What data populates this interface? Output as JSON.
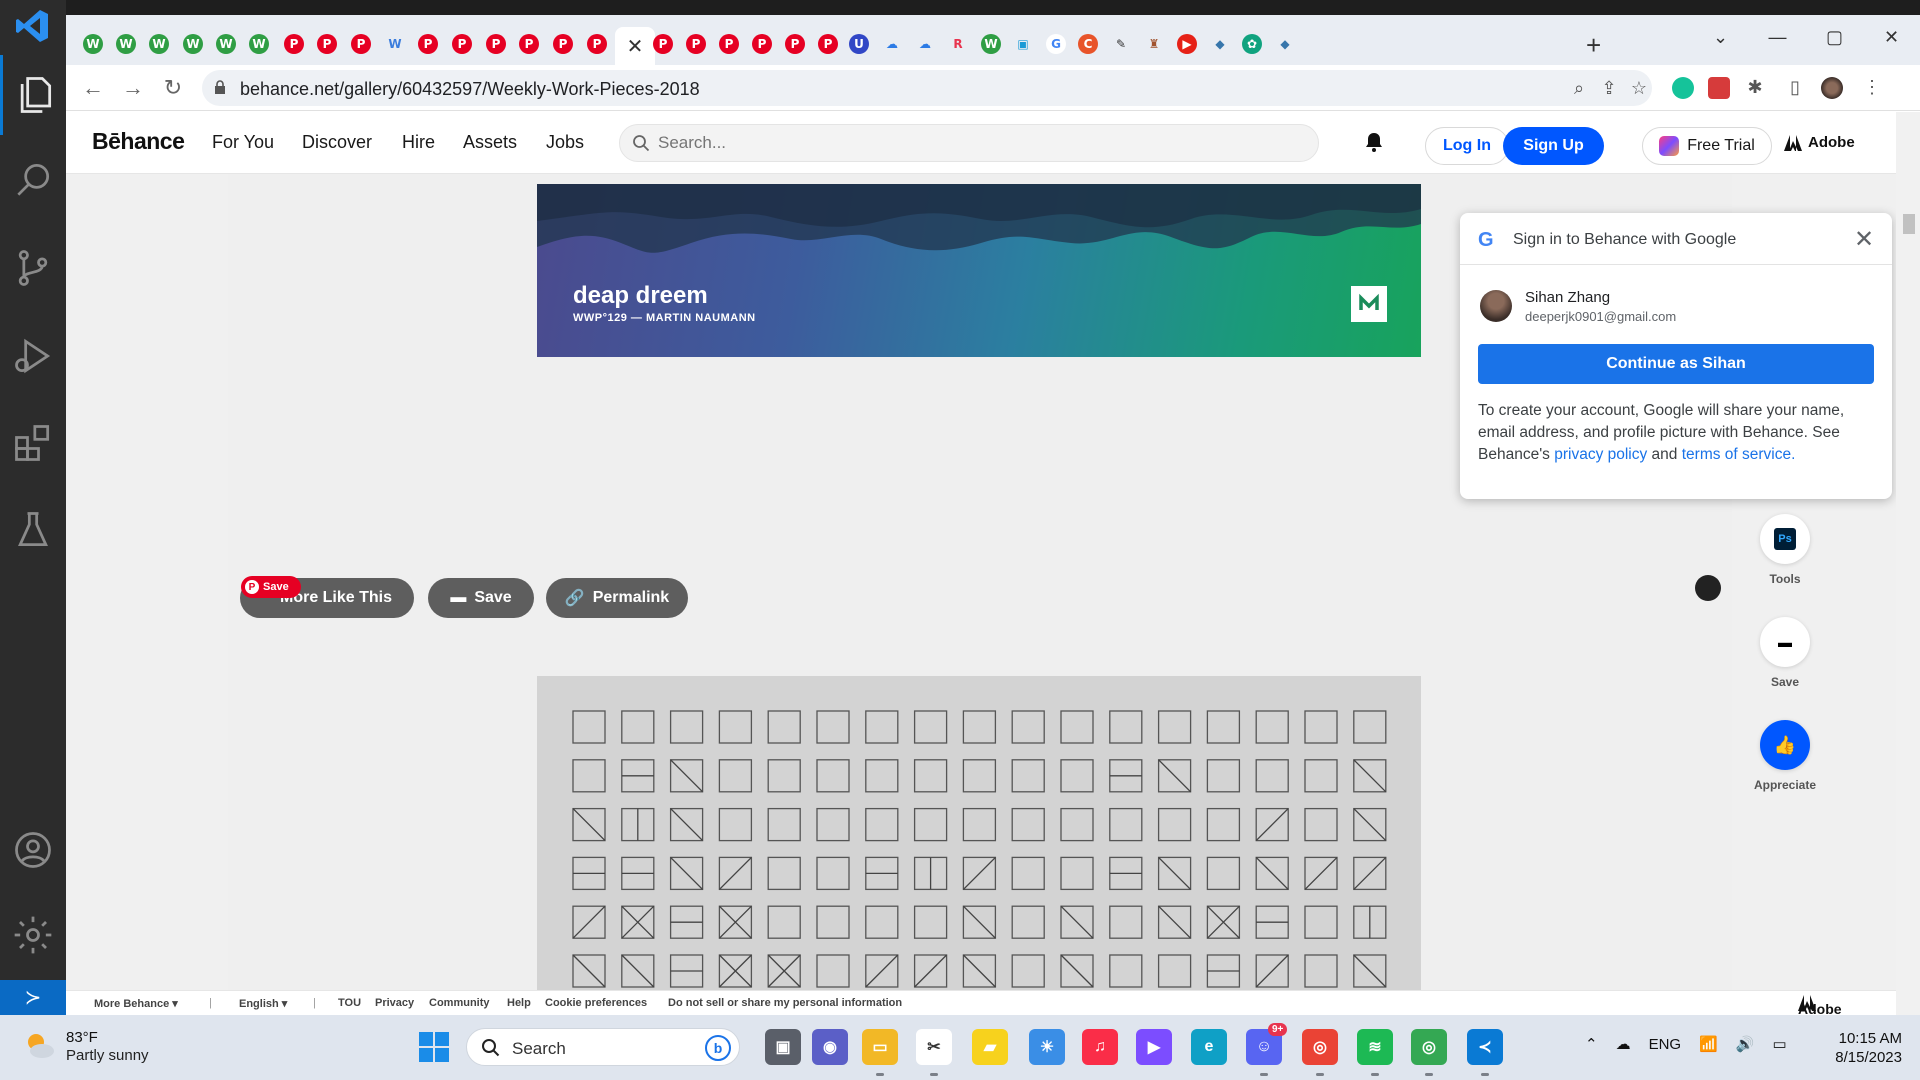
{
  "browser": {
    "url": "behance.net/gallery/60432597/Weekly-Work-Pieces-2018",
    "window_controls": [
      "⌄",
      "—",
      "▢",
      "✕"
    ],
    "tabs": [
      {
        "icon": "w-icon",
        "glyph": "W",
        "color": "#2f9e44",
        "text_color": "#fff"
      },
      {
        "icon": "w-icon",
        "glyph": "W",
        "color": "#2f9e44",
        "text_color": "#fff"
      },
      {
        "icon": "w-icon",
        "glyph": "W",
        "color": "#2f9e44",
        "text_color": "#fff"
      },
      {
        "icon": "w-icon",
        "glyph": "W",
        "color": "#2f9e44",
        "text_color": "#fff"
      },
      {
        "icon": "w-icon",
        "glyph": "W",
        "color": "#2f9e44",
        "text_color": "#fff"
      },
      {
        "icon": "w-icon",
        "glyph": "W",
        "color": "#2f9e44",
        "text_color": "#fff"
      },
      {
        "icon": "pinterest-icon",
        "glyph": "P",
        "color": "#e60023",
        "text_color": "#fff"
      },
      {
        "icon": "pinterest-icon",
        "glyph": "P",
        "color": "#e60023",
        "text_color": "#fff"
      },
      {
        "icon": "pinterest-icon",
        "glyph": "P",
        "color": "#e60023",
        "text_color": "#fff"
      },
      {
        "icon": "wix-icon",
        "glyph": "W",
        "color": "#e9edf3",
        "text_color": "#3b7ddd"
      },
      {
        "icon": "pinterest-icon",
        "glyph": "P",
        "color": "#e60023",
        "text_color": "#fff"
      },
      {
        "icon": "pinterest-icon",
        "glyph": "P",
        "color": "#e60023",
        "text_color": "#fff"
      },
      {
        "icon": "pinterest-icon",
        "glyph": "P",
        "color": "#e60023",
        "text_color": "#fff"
      },
      {
        "icon": "pinterest-icon",
        "glyph": "P",
        "color": "#e60023",
        "text_color": "#fff"
      },
      {
        "icon": "pinterest-icon",
        "glyph": "P",
        "color": "#e60023",
        "text_color": "#fff"
      },
      {
        "icon": "pinterest-icon",
        "glyph": "P",
        "color": "#e60023",
        "text_color": "#fff"
      },
      {
        "icon": "close-tab-icon",
        "glyph": "✕",
        "color": "#fff",
        "text_color": "#333",
        "active": true
      },
      {
        "icon": "pinterest-icon",
        "glyph": "P",
        "color": "#e60023",
        "text_color": "#fff"
      },
      {
        "icon": "pinterest-icon",
        "glyph": "P",
        "color": "#e60023",
        "text_color": "#fff"
      },
      {
        "icon": "pinterest-icon",
        "glyph": "P",
        "color": "#e60023",
        "text_color": "#fff"
      },
      {
        "icon": "pinterest-icon",
        "glyph": "P",
        "color": "#e60023",
        "text_color": "#fff"
      },
      {
        "icon": "pinterest-icon",
        "glyph": "P",
        "color": "#e60023",
        "text_color": "#fff"
      },
      {
        "icon": "pinterest-icon",
        "glyph": "P",
        "color": "#e60023",
        "text_color": "#fff"
      },
      {
        "icon": "u-icon",
        "glyph": "U",
        "color": "#3147c6",
        "text_color": "#fff"
      },
      {
        "icon": "cloud-icon",
        "glyph": "☁",
        "color": "#e9edf3",
        "text_color": "#2c7be5"
      },
      {
        "icon": "cloud-icon",
        "glyph": "☁",
        "color": "#e9edf3",
        "text_color": "#2c7be5"
      },
      {
        "icon": "r-icon",
        "glyph": "R",
        "color": "#e9edf3",
        "text_color": "#e8344e"
      },
      {
        "icon": "w-icon",
        "glyph": "W",
        "color": "#2f9e44",
        "text_color": "#fff"
      },
      {
        "icon": "bilibili-icon",
        "glyph": "▣",
        "color": "#e9edf3",
        "text_color": "#1a9ad6"
      },
      {
        "icon": "google-icon",
        "glyph": "G",
        "color": "#fff",
        "text_color": "#4285f4"
      },
      {
        "icon": "c-icon",
        "glyph": "C",
        "color": "#e8542a",
        "text_color": "#fff"
      },
      {
        "icon": "inkscape-icon",
        "glyph": "✎",
        "color": "#e9edf3",
        "text_color": "#333"
      },
      {
        "icon": "chess-icon",
        "glyph": "♜",
        "color": "#e9edf3",
        "text_color": "#a0522d"
      },
      {
        "icon": "youtube-icon",
        "glyph": "▶",
        "color": "#e62117",
        "text_color": "#fff"
      },
      {
        "icon": "python-icon",
        "glyph": "◆",
        "color": "#e9edf3",
        "text_color": "#3776ab"
      },
      {
        "icon": "openai-icon",
        "glyph": "✿",
        "color": "#10a37f",
        "text_color": "#fff"
      },
      {
        "icon": "python-icon",
        "glyph": "◆",
        "color": "#e9edf3",
        "text_color": "#3776ab"
      }
    ],
    "new_tab": "+"
  },
  "behance": {
    "logo": "Bēhance",
    "nav": [
      "For You",
      "Discover",
      "Hire",
      "Assets",
      "Jobs"
    ],
    "search_placeholder": "Search...",
    "login": "Log In",
    "signup": "Sign Up",
    "free_trial": "Free Trial",
    "adobe": "Adobe"
  },
  "project": {
    "banner_title": "deap dreem",
    "banner_subtitle": "WWP°129 — MARTIN NAUMANN",
    "pin_save": "Save",
    "more_like_this": "More Like This",
    "save": "Save",
    "permalink": "Permalink"
  },
  "rail": {
    "tools": "Tools",
    "ps": "Ps",
    "save": "Save",
    "appreciate": "Appreciate"
  },
  "google_popup": {
    "title": "Sign in to Behance with Google",
    "name": "Sihan Zhang",
    "email": "deeperjk0901@gmail.com",
    "continue": "Continue as Sihan",
    "desc_pre": "To create your account, Google will share your name, email address, and profile picture with Behance. See Behance's ",
    "privacy": "privacy policy",
    "and": " and ",
    "terms": "terms of service",
    "period": "."
  },
  "footer": {
    "more_behance": "More Behance ▾",
    "language": "English ▾",
    "links": [
      "TOU",
      "Privacy",
      "Community",
      "Help",
      "Cookie preferences",
      "Do not sell or share my personal information"
    ],
    "adobe": "Adobe"
  },
  "taskbar": {
    "temp": "83°F",
    "weather": "Partly sunny",
    "search": "Search",
    "tray_lang": "ENG",
    "time": "10:15 AM",
    "date": "8/15/2023",
    "discord_badge": "9+"
  },
  "colors": {
    "behance_blue": "#0057ff",
    "google_blue": "#1a73e8",
    "pinterest_red": "#e60023"
  }
}
